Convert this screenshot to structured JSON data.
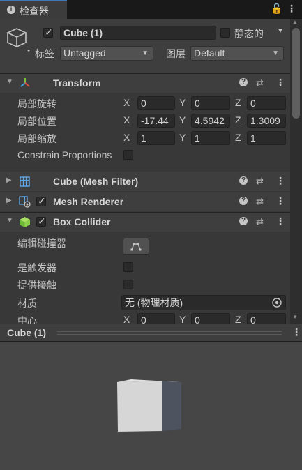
{
  "tab": {
    "label": "检查器"
  },
  "header": {
    "name": "Cube (1)",
    "static_label": "静态的",
    "tag_label": "标签",
    "tag_value": "Untagged",
    "layer_label": "图层",
    "layer_value": "Default"
  },
  "transform": {
    "title": "Transform",
    "rows": [
      {
        "label": "局部旋转",
        "x": "0",
        "y": "0",
        "z": "0"
      },
      {
        "label": "局部位置",
        "x": "-17.44",
        "y": "4.5942",
        "z": "1.3009"
      },
      {
        "label": "局部缩放",
        "x": "1",
        "y": "1",
        "z": "1"
      }
    ],
    "constrain_label": "Constrain Proportions"
  },
  "axes": {
    "x": "X",
    "y": "Y",
    "z": "Z"
  },
  "mesh_filter": {
    "title": "Cube (Mesh Filter)"
  },
  "mesh_renderer": {
    "title": "Mesh Renderer"
  },
  "box_collider": {
    "title": "Box Collider",
    "edit_label": "编辑碰撞器",
    "is_trigger_label": "是触发器",
    "provides_contacts_label": "提供接触",
    "material_label": "材质",
    "material_value": "无 (物理材质)",
    "center_label": "中心",
    "center": {
      "x": "0",
      "y": "0",
      "z": "0"
    }
  },
  "preview": {
    "title": "Cube (1)"
  },
  "colors": {
    "accent": "#3a79bb",
    "bg": "#383838",
    "field": "#2a2a2a"
  }
}
